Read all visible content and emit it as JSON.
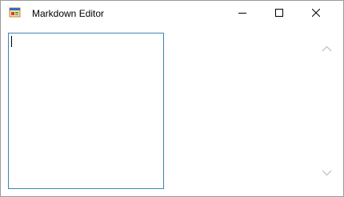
{
  "window": {
    "title": "Markdown Editor",
    "app_icon": "notepad-form-icon",
    "controls": {
      "minimize": "minimize-icon",
      "maximize": "maximize-icon",
      "close": "close-icon"
    }
  },
  "editor": {
    "value": "",
    "placeholder": ""
  },
  "scrollbar": {
    "up_icon": "chevron-up-icon",
    "down_icon": "chevron-down-icon"
  },
  "colors": {
    "editor_border": "#3c85b4",
    "window_border": "#9a9a9a",
    "scroll_arrow": "#c8c8c8"
  }
}
